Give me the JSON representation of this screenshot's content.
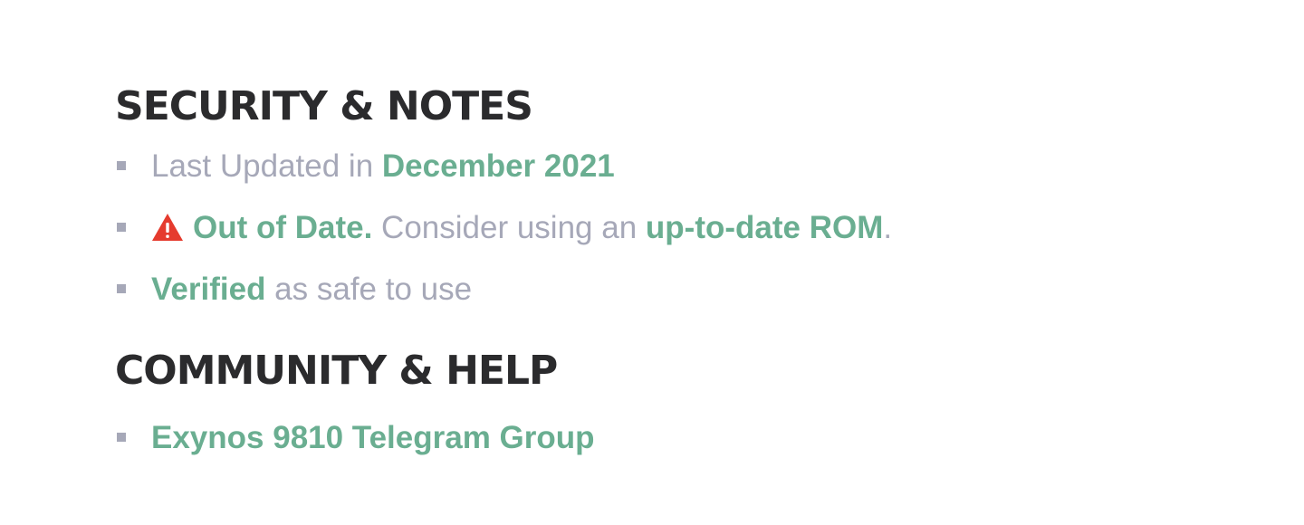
{
  "security": {
    "title": "SECURITY & NOTES",
    "updated": {
      "prefix": "Last Updated in ",
      "date": "December 2021"
    },
    "status": {
      "warning": "Out of Date.",
      "text": " Consider using an ",
      "link": "up-to-date ROM",
      "suffix": "."
    },
    "verified": {
      "link": "Verified",
      "text": " as safe to use"
    }
  },
  "community": {
    "title": "COMMUNITY & HELP",
    "links": [
      {
        "label": "Exynos 9810 Telegram Group"
      }
    ]
  },
  "colors": {
    "heading": "#2b2b2d",
    "muted": "#a6a8b8",
    "accent": "#6aae91",
    "warning": "#e53b2e"
  },
  "icons": {
    "warning": "warning-triangle-icon",
    "bullet": "square-bullet-icon"
  }
}
